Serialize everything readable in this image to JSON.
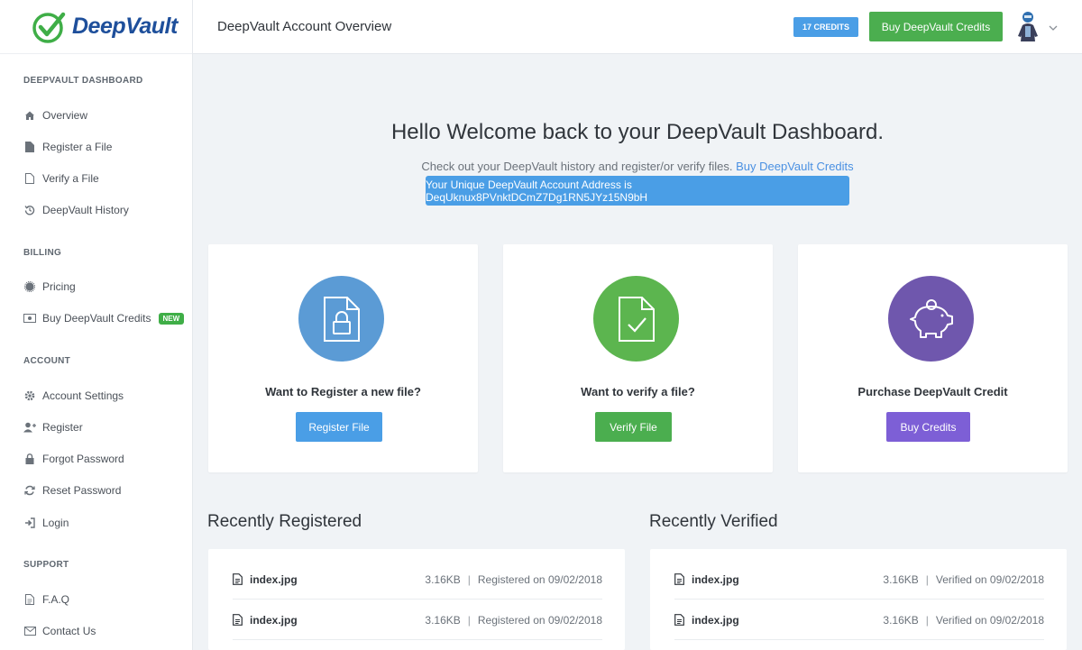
{
  "brand": {
    "name": "DeepVault"
  },
  "header": {
    "title": "DeepVault Account Overview",
    "credits": "17 CREDITS",
    "buy_label": "Buy DeepVault Credits"
  },
  "sidebar": {
    "sections": [
      {
        "label": "DEEPVAULT DASHBOARD",
        "items": [
          {
            "label": "Overview",
            "icon": "home-icon"
          },
          {
            "label": "Register a File",
            "icon": "file-filled-icon"
          },
          {
            "label": "Verify a File",
            "icon": "file-outline-icon"
          },
          {
            "label": "DeepVault History",
            "icon": "history-icon"
          }
        ]
      },
      {
        "label": "BILLING",
        "items": [
          {
            "label": "Pricing",
            "icon": "certificate-icon"
          },
          {
            "label": "Buy DeepVault Credits",
            "icon": "money-icon",
            "badge": "NEW"
          }
        ]
      },
      {
        "label": "ACCOUNT",
        "items": [
          {
            "label": "Account Settings",
            "icon": "gear-icon"
          },
          {
            "label": "Register",
            "icon": "user-plus-icon"
          },
          {
            "label": "Forgot Password",
            "icon": "lock-icon"
          },
          {
            "label": "Reset Password",
            "icon": "refresh-icon"
          },
          {
            "label": "Login",
            "icon": "sign-in-icon"
          }
        ]
      },
      {
        "label": "SUPPORT",
        "items": [
          {
            "label": "F.A.Q",
            "icon": "document-icon"
          },
          {
            "label": "Contact Us",
            "icon": "envelope-icon"
          }
        ]
      }
    ]
  },
  "hero": {
    "title": "Hello Welcome back to your DeepVault Dashboard.",
    "subtitle": "Check out your DeepVault history and register/or verify files.",
    "subtitle_link": "Buy DeepVault Credits",
    "address": "Your Unique DeepVault Account Address is DeqUknux8PVnktDCmZ7Dg1RN5JYz15N9bH"
  },
  "cards": [
    {
      "title": "Want to Register a new file?",
      "button": "Register File",
      "icon": "file-lock-icon",
      "color": "#5b9bd5",
      "button_color": "#4a9ee6"
    },
    {
      "title": "Want to verify a file?",
      "button": "Verify File",
      "icon": "file-check-icon",
      "color": "#5cb54f",
      "button_color": "#4bae4f"
    },
    {
      "title": "Purchase DeepVault Credit",
      "button": "Buy Credits",
      "icon": "piggy-bank-icon",
      "color": "#6f57ad",
      "button_color": "#7d5fd6"
    }
  ],
  "recently_registered": {
    "title": "Recently Registered",
    "rows": [
      {
        "file": "index.jpg",
        "size": "3.16KB",
        "status": "Registered on 09/02/2018"
      },
      {
        "file": "index.jpg",
        "size": "3.16KB",
        "status": "Registered on 09/02/2018"
      }
    ]
  },
  "recently_verified": {
    "title": "Recently Verified",
    "rows": [
      {
        "file": "index.jpg",
        "size": "3.16KB",
        "status": "Verified on 09/02/2018"
      },
      {
        "file": "index.jpg",
        "size": "3.16KB",
        "status": "Verified on 09/02/2018"
      }
    ]
  },
  "colors": {
    "accent_blue": "#4a9ee6",
    "accent_green": "#4bae4f",
    "accent_purple": "#7d5fd6",
    "brand_navy": "#1e4f9b"
  }
}
